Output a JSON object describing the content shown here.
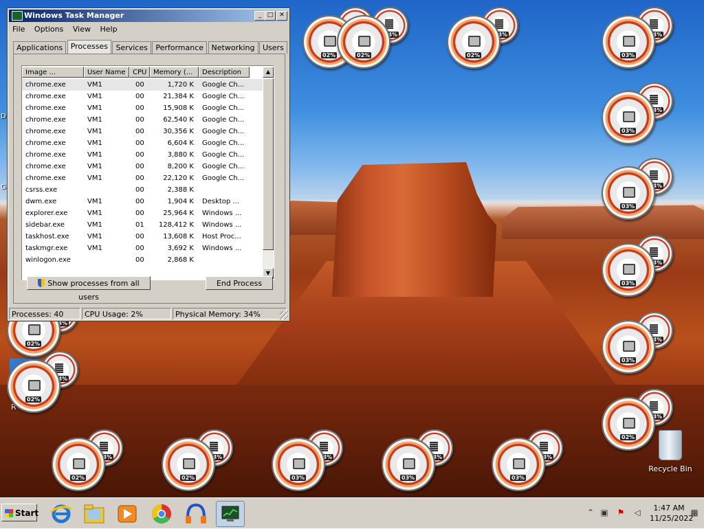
{
  "window": {
    "title": "Windows Task Manager",
    "controls": {
      "minimize": "_",
      "maximize": "□",
      "close": "✕"
    }
  },
  "menu": [
    "File",
    "Options",
    "View",
    "Help"
  ],
  "tabs": [
    {
      "label": "Applications",
      "active": false
    },
    {
      "label": "Processes",
      "active": true
    },
    {
      "label": "Services",
      "active": false
    },
    {
      "label": "Performance",
      "active": false
    },
    {
      "label": "Networking",
      "active": false
    },
    {
      "label": "Users",
      "active": false
    }
  ],
  "process_table": {
    "columns": [
      "Image ...",
      "User Name",
      "CPU",
      "Memory (...",
      "Description"
    ],
    "rows": [
      {
        "image": "chrome.exe",
        "user": "VM1",
        "cpu": "00",
        "memory": "1,720 K",
        "description": "Google Ch..."
      },
      {
        "image": "chrome.exe",
        "user": "VM1",
        "cpu": "00",
        "memory": "21,384 K",
        "description": "Google Ch..."
      },
      {
        "image": "chrome.exe",
        "user": "VM1",
        "cpu": "00",
        "memory": "15,908 K",
        "description": "Google Ch..."
      },
      {
        "image": "chrome.exe",
        "user": "VM1",
        "cpu": "00",
        "memory": "62,540 K",
        "description": "Google Ch..."
      },
      {
        "image": "chrome.exe",
        "user": "VM1",
        "cpu": "00",
        "memory": "30,356 K",
        "description": "Google Ch..."
      },
      {
        "image": "chrome.exe",
        "user": "VM1",
        "cpu": "00",
        "memory": "6,604 K",
        "description": "Google Ch..."
      },
      {
        "image": "chrome.exe",
        "user": "VM1",
        "cpu": "00",
        "memory": "3,880 K",
        "description": "Google Ch..."
      },
      {
        "image": "chrome.exe",
        "user": "VM1",
        "cpu": "00",
        "memory": "8,200 K",
        "description": "Google Ch..."
      },
      {
        "image": "chrome.exe",
        "user": "VM1",
        "cpu": "00",
        "memory": "22,120 K",
        "description": "Google Ch..."
      },
      {
        "image": "csrss.exe",
        "user": "",
        "cpu": "00",
        "memory": "2,388 K",
        "description": ""
      },
      {
        "image": "dwm.exe",
        "user": "VM1",
        "cpu": "00",
        "memory": "1,904 K",
        "description": "Desktop ..."
      },
      {
        "image": "explorer.exe",
        "user": "VM1",
        "cpu": "00",
        "memory": "25,964 K",
        "description": "Windows ..."
      },
      {
        "image": "sidebar.exe",
        "user": "VM1",
        "cpu": "01",
        "memory": "128,412 K",
        "description": "Windows ..."
      },
      {
        "image": "taskhost.exe",
        "user": "VM1",
        "cpu": "00",
        "memory": "13,608 K",
        "description": "Host Proc..."
      },
      {
        "image": "taskmgr.exe",
        "user": "VM1",
        "cpu": "00",
        "memory": "3,692 K",
        "description": "Windows ..."
      },
      {
        "image": "winlogon.exe",
        "user": "",
        "cpu": "00",
        "memory": "2,868 K",
        "description": ""
      }
    ]
  },
  "buttons": {
    "show_all": "Show processes from all users",
    "end_process": "End Process"
  },
  "status_bar": {
    "processes": "Processes: 40",
    "cpu": "CPU Usage: 2%",
    "memory": "Physical Memory: 34%"
  },
  "gadgets": [
    {
      "cpu": "02%",
      "mem": "34%"
    },
    {
      "cpu": "02%",
      "mem": "34%"
    },
    {
      "cpu": "02%",
      "mem": "34%"
    },
    {
      "cpu": "03%",
      "mem": "34%"
    },
    {
      "cpu": "03%",
      "mem": "34%"
    },
    {
      "cpu": "03%",
      "mem": "34%"
    },
    {
      "cpu": "03%",
      "mem": "34%"
    },
    {
      "cpu": "03%",
      "mem": "34%"
    },
    {
      "cpu": "02%",
      "mem": "34%"
    },
    {
      "cpu": "02%",
      "mem": "34%"
    },
    {
      "cpu": "02%",
      "mem": "34%"
    },
    {
      "cpu": "03%",
      "mem": "34%"
    },
    {
      "cpu": "03%",
      "mem": "34%"
    },
    {
      "cpu": "03%",
      "mem": "34%"
    },
    {
      "cpu": "02%",
      "mem": "34%"
    },
    {
      "cpu": "02%",
      "mem": "34%"
    }
  ],
  "desktop": {
    "recycle_bin": "Recycle Bin",
    "partial_icon_label": "R",
    "edge_letters": [
      "D",
      "G"
    ]
  },
  "taskbar": {
    "start": "Start",
    "apps": [
      "internet-explorer-icon",
      "file-explorer-icon",
      "media-player-icon",
      "chrome-icon",
      "audio-app-icon",
      "task-manager-icon"
    ],
    "tray_icons": [
      "show-hidden-icons-arrow",
      "network-icon",
      "action-center-icon",
      "volume-icon"
    ],
    "clock_time": "1:47 AM",
    "clock_date": "11/25/2022"
  }
}
